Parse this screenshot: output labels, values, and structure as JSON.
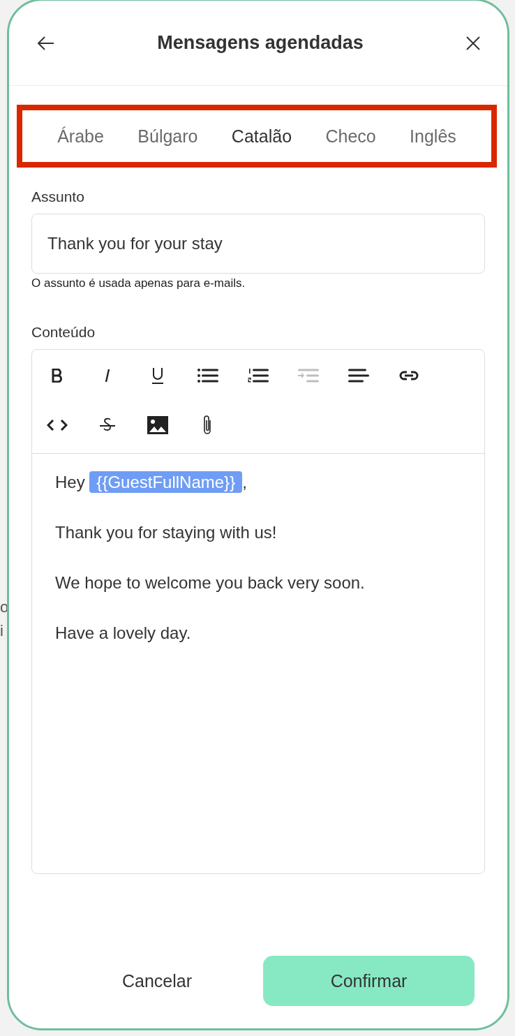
{
  "background": {
    "fragments": [
      "o",
      "i"
    ]
  },
  "dialog": {
    "title": "Mensagens agendadas"
  },
  "tabs": [
    {
      "label": "Árabe",
      "selected": false
    },
    {
      "label": "Búlgaro",
      "selected": false
    },
    {
      "label": "Catalão",
      "selected": true
    },
    {
      "label": "Checo",
      "selected": false
    },
    {
      "label": "Inglês",
      "selected": false
    }
  ],
  "subject": {
    "label": "Assunto",
    "value": "Thank you for your stay",
    "hint": "O assunto é usada apenas para e-mails."
  },
  "content": {
    "label": "Conteúdo",
    "toolbar": [
      {
        "kind": "bold",
        "disabled": false
      },
      {
        "kind": "italic",
        "disabled": false
      },
      {
        "kind": "underline",
        "disabled": false
      },
      {
        "kind": "bullets",
        "disabled": false
      },
      {
        "kind": "numbers",
        "disabled": false
      },
      {
        "kind": "indent",
        "disabled": true
      },
      {
        "kind": "align",
        "disabled": false
      },
      {
        "kind": "link",
        "disabled": false
      },
      {
        "kind": "code",
        "disabled": false
      },
      {
        "kind": "strike",
        "disabled": false
      },
      {
        "kind": "image",
        "disabled": false
      },
      {
        "kind": "attach",
        "disabled": false
      }
    ],
    "paragraphs": [
      [
        {
          "kind": "text",
          "text": "Hey "
        },
        {
          "kind": "tag",
          "text": "{{GuestFullName}}"
        },
        {
          "kind": "text",
          "text": ","
        }
      ],
      [
        {
          "kind": "text",
          "text": "Thank you for staying with us!"
        }
      ],
      [
        {
          "kind": "text",
          "text": "We hope to welcome you back very soon."
        }
      ],
      [
        {
          "kind": "text",
          "text": "Have a lovely day."
        }
      ]
    ]
  },
  "buttons": {
    "cancel": "Cancelar",
    "confirm": "Confirmar"
  }
}
